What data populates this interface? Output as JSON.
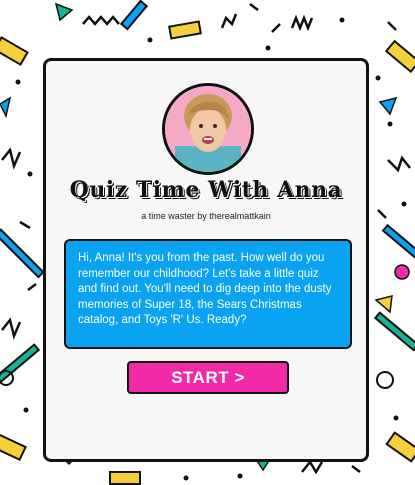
{
  "quiz": {
    "title": "Quiz Time With Anna",
    "subtitle": "a time waster by therealmattkain",
    "message": "Hi, Anna! It's you from the past. How well do you remember our childhood? Let's take a little quiz and find out. You'll need to dig deep into the dusty memories of Super 18, the Sears Christmas catalog, and Toys 'R' Us. Ready?",
    "start_label": "START >"
  },
  "colors": {
    "pink": "#f22aa8",
    "blue": "#0aa3f2",
    "yellow": "#f5d03a",
    "teal": "#18b394",
    "purple": "#5b2a86",
    "black": "#111111"
  }
}
